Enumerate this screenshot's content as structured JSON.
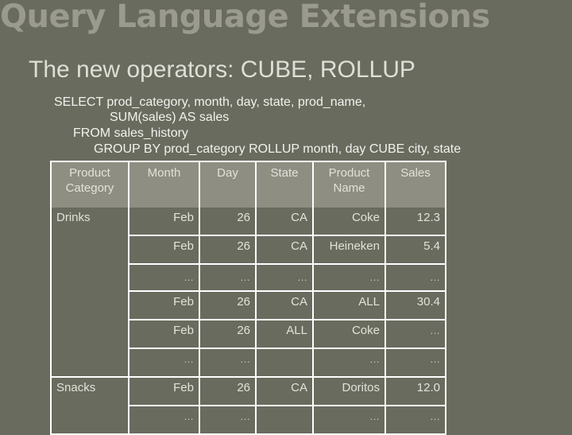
{
  "slide": {
    "title": "Query Language Extensions",
    "subtitle": "The new operators: CUBE, ROLLUP",
    "sql": [
      "SELECT prod_category, month, day, state, prod_name,",
      "SUM(sales) AS sales",
      "FROM sales_history",
      "GROUP BY prod_category  ROLLUP month, day   CUBE city, state"
    ]
  },
  "table": {
    "headers": [
      "Product Category",
      "Month",
      "Day",
      "State",
      "Product Name",
      "Sales"
    ],
    "groups": [
      {
        "category": "Drinks",
        "rows": [
          [
            "Feb",
            "26",
            "CA",
            "Coke",
            "12.3"
          ],
          [
            "Feb",
            "26",
            "CA",
            "Heineken",
            "5.4"
          ],
          [
            "…",
            "…",
            "…",
            "…",
            "…"
          ],
          [
            "Feb",
            "26",
            "CA",
            "ALL",
            "30.4"
          ],
          [
            "Feb",
            "26",
            "ALL",
            "Coke",
            "…"
          ],
          [
            "…",
            "…",
            "",
            "…",
            "…"
          ]
        ]
      },
      {
        "category": "Snacks",
        "rows": [
          [
            "Feb",
            "26",
            "CA",
            "Doritos",
            "12.0"
          ],
          [
            "…",
            "…",
            "",
            "…",
            "…"
          ]
        ]
      }
    ]
  },
  "colors": {
    "background": "#696b5e",
    "header_cell": "#8e8f82",
    "title": "#9a9b8e",
    "border": "#ffffff"
  }
}
